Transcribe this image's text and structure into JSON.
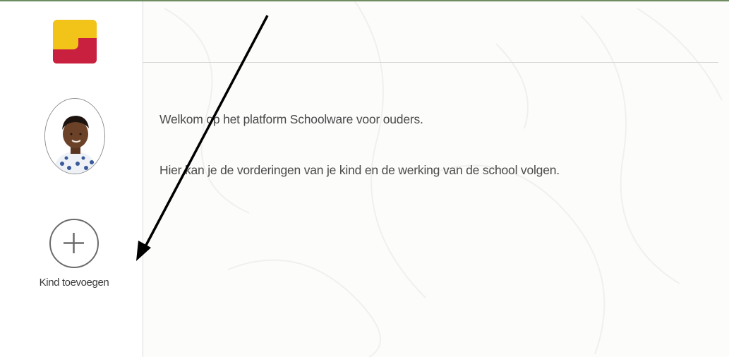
{
  "sidebar": {
    "logo_icon": "schoolware-logo",
    "avatar_icon": "child-avatar",
    "add_child": {
      "icon": "plus-circle-icon",
      "label": "Kind toevoegen"
    }
  },
  "main": {
    "welcome_line1": "Welkom op het platform Schoolware voor ouders.",
    "welcome_line2": "Hier kan je de vorderingen van je kind en de werking van de school volgen."
  },
  "colors": {
    "top_border": "#6d8d60",
    "logo_yellow": "#f2c318",
    "logo_red": "#c8203e",
    "text": "#4a4a4a"
  },
  "annotation": {
    "type": "arrow",
    "color": "#000000"
  }
}
